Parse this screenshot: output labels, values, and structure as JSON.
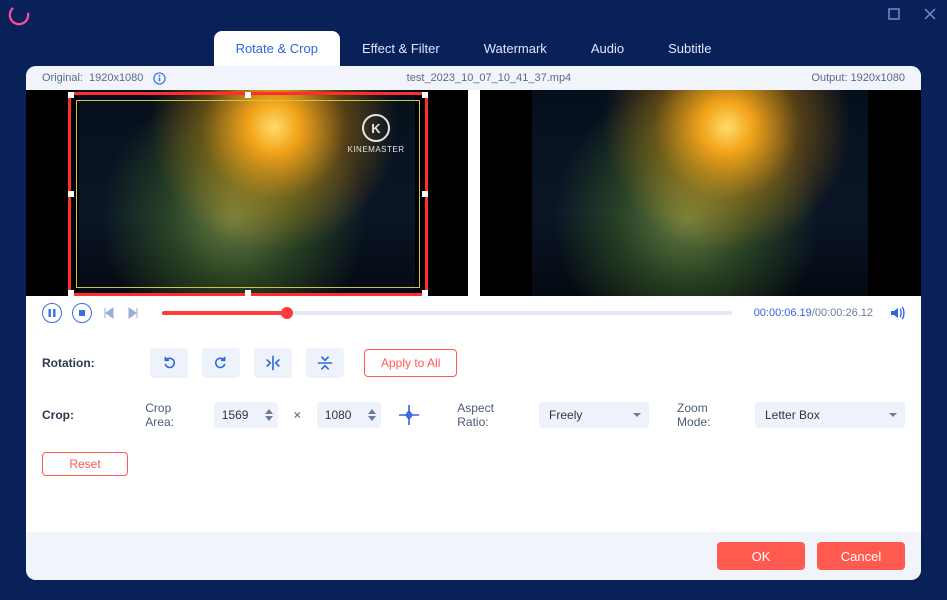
{
  "window": {
    "maximize_label": "maximize",
    "close_label": "close"
  },
  "tabs": [
    {
      "label": "Rotate & Crop",
      "active": true
    },
    {
      "label": "Effect & Filter",
      "active": false
    },
    {
      "label": "Watermark",
      "active": false
    },
    {
      "label": "Audio",
      "active": false
    },
    {
      "label": "Subtitle",
      "active": false
    }
  ],
  "info": {
    "original_label": "Original:",
    "original_value": "1920x1080",
    "filename": "test_2023_10_07_10_41_37.mp4",
    "output_label": "Output:",
    "output_value": "1920x1080"
  },
  "watermark": {
    "brand": "KINEMASTER",
    "initial": "K"
  },
  "playback": {
    "current": "00:00:06.19",
    "duration": "00:00:26.12",
    "progress_pct": 22
  },
  "rotation": {
    "label": "Rotation:",
    "apply_all": "Apply to All"
  },
  "crop": {
    "label": "Crop:",
    "area_label": "Crop Area:",
    "width": "1569",
    "height": "1080",
    "aspect_label": "Aspect Ratio:",
    "aspect_value": "Freely",
    "zoom_label": "Zoom Mode:",
    "zoom_value": "Letter Box",
    "reset": "Reset"
  },
  "footer": {
    "ok": "OK",
    "cancel": "Cancel"
  }
}
